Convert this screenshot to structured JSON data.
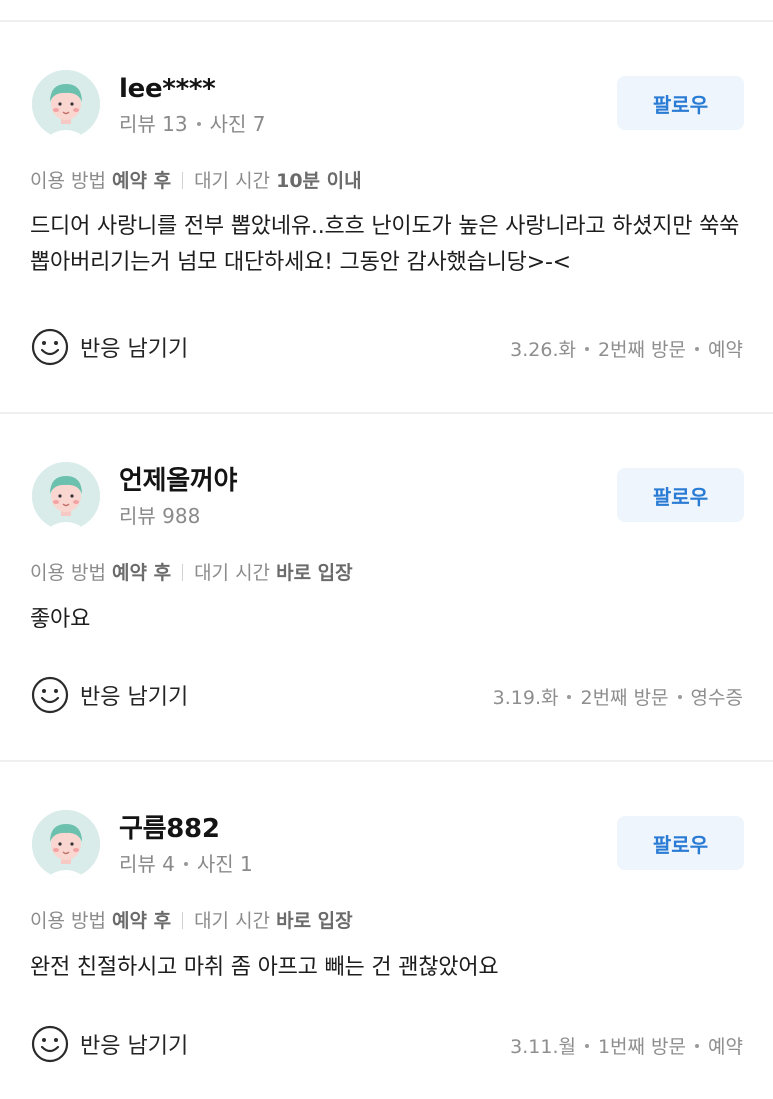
{
  "reviews": [
    {
      "nickname": "lee****",
      "stats": [
        "리뷰 13",
        "사진 7"
      ],
      "follow_label": "팔로우",
      "usage_label": "이용 방법",
      "usage_value": "예약 후",
      "wait_label": "대기 시간",
      "wait_value": "10분 이내",
      "text": "드디어 사랑니를 전부 뽑았네유..흐흐 난이도가 높은 사랑니라고 하셨지만 쑥쑥 뽑아버리기는거 넘모 대단하세요! 그동안 감사했습니당>-<",
      "react_label": "반응 남기기",
      "visit": [
        "3.26.화",
        "2번째 방문",
        "예약"
      ]
    },
    {
      "nickname": "언제올꺼야",
      "stats": [
        "리뷰 988"
      ],
      "follow_label": "팔로우",
      "usage_label": "이용 방법",
      "usage_value": "예약 후",
      "wait_label": "대기 시간",
      "wait_value": "바로 입장",
      "text": "좋아요",
      "react_label": "반응 남기기",
      "visit": [
        "3.19.화",
        "2번째 방문",
        "영수증"
      ]
    },
    {
      "nickname": "구름882",
      "stats": [
        "리뷰 4",
        "사진 1"
      ],
      "follow_label": "팔로우",
      "usage_label": "이용 방법",
      "usage_value": "예약 후",
      "wait_label": "대기 시간",
      "wait_value": "바로 입장",
      "text": "완전 친절하시고 마취 좀 아프고 빼는 건 괜찮았어요",
      "react_label": "반응 남기기",
      "visit": [
        "3.11.월",
        "1번째 방문",
        "예약"
      ]
    }
  ],
  "icons": {
    "avatar": "user-avatar-icon",
    "react": "smile-icon"
  },
  "colors": {
    "follow_bg": "#eef5fd",
    "follow_text": "#2a7bd4",
    "divider": "#eeeff1"
  }
}
